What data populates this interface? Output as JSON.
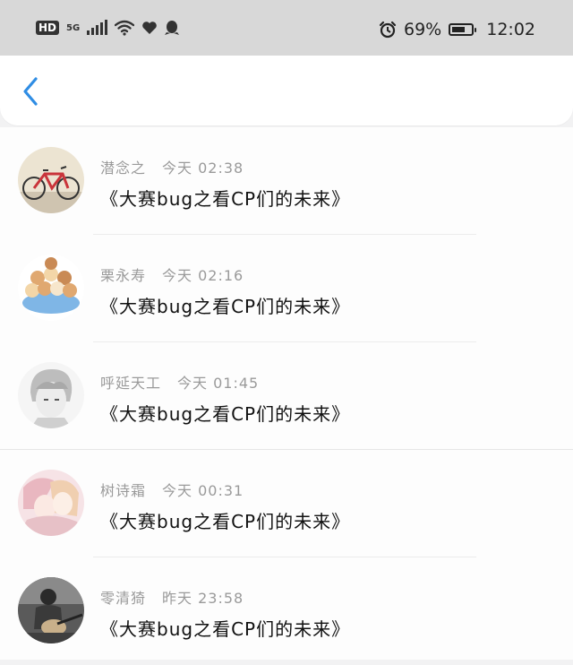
{
  "status_bar": {
    "hd": "HD",
    "network": "5G",
    "battery_percent": "69%",
    "battery_level": 0.69,
    "time": "12:02",
    "icons": [
      "hd-icon",
      "signal-icon",
      "wifi-icon",
      "heart-icon",
      "qq-penguin-icon",
      "alarm-icon",
      "battery-icon"
    ]
  },
  "nav": {
    "back_icon": "chevron-left-icon",
    "accent": "#2f8de4"
  },
  "messages": [
    {
      "name": "潜念之",
      "time": "今天 02:38",
      "text": "《大赛bug之看CP们的未来》",
      "avatar": "bicycle-photo"
    },
    {
      "name": "栗永寿",
      "time": "今天 02:16",
      "text": "《大赛bug之看CP们的未来》",
      "avatar": "cats-in-bowl"
    },
    {
      "name": "呼延天工",
      "time": "今天 01:45",
      "text": "《大赛bug之看CP们的未来》",
      "avatar": "anime-boy-sketch"
    },
    {
      "name": "树诗霜",
      "time": "今天 00:31",
      "text": "《大赛bug之看CP们的未来》",
      "avatar": "anime-couple-pink"
    },
    {
      "name": "零清猗",
      "time": "昨天 23:58",
      "text": "《大赛bug之看CP们的未来》",
      "avatar": "guitar-photo"
    }
  ]
}
